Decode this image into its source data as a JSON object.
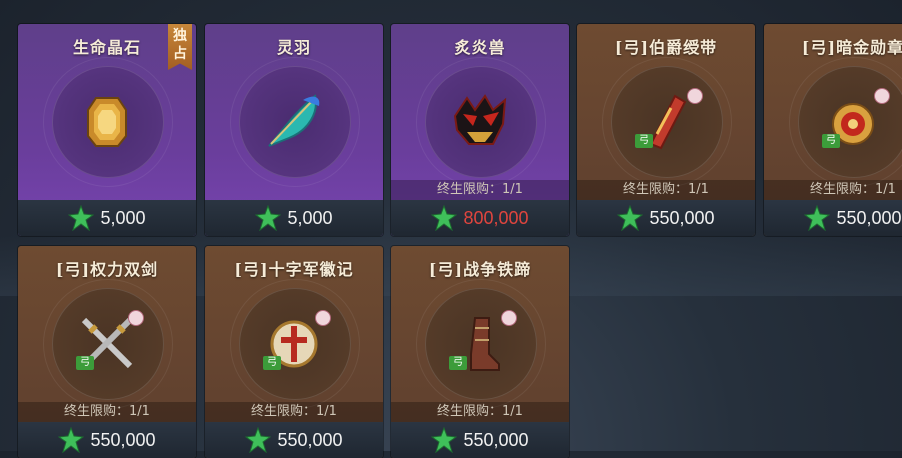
{
  "colors": {
    "purple": "#6a3e9c",
    "bronze": "#654430",
    "price_red": "#e0453e",
    "gem_green": "#3fbf5a"
  },
  "limit_text": "终生限购：1/1",
  "tag_text": "弓",
  "cards": [
    {
      "name": "生命晶石",
      "price": "5,000",
      "exclusive": "独占",
      "icon": "amber-gem-icon",
      "theme": "purple"
    },
    {
      "name": "灵羽",
      "price": "5,000",
      "icon": "teal-feather-icon",
      "theme": "purple"
    },
    {
      "name": "炙炎兽",
      "price": "800,000",
      "price_red": true,
      "limit": "终生限购：1/1",
      "icon": "fire-beast-head-icon",
      "theme": "purple"
    },
    {
      "name": "[弓]伯爵绶带",
      "price": "550,000",
      "limit": "终生限购：1/1",
      "icon": "sash-icon",
      "theme": "bronze"
    },
    {
      "name": "[弓]暗金勋章",
      "price": "550,000",
      "limit": "终生限购：1/1",
      "icon": "medal-icon",
      "theme": "bronze"
    },
    {
      "name": "[弓]权力双剑",
      "price": "550,000",
      "limit": "终生限购：1/1",
      "icon": "crossed-swords-icon",
      "theme": "bronze"
    },
    {
      "name": "[弓]十字军徽记",
      "price": "550,000",
      "limit": "终生限购：1/1",
      "icon": "crusader-emblem-icon",
      "theme": "bronze"
    },
    {
      "name": "[弓]战争铁蹄",
      "price": "550,000",
      "limit": "终生限购：1/1",
      "icon": "war-boot-icon",
      "theme": "bronze"
    }
  ]
}
